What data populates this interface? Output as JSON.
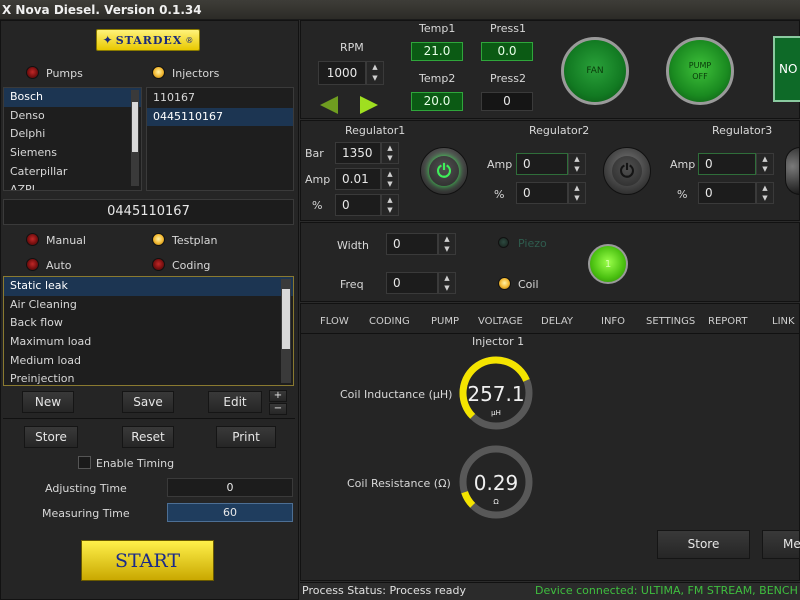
{
  "window": {
    "title": "X Nova Diesel. Version 0.1.34"
  },
  "logo": {
    "text": "STARDEX",
    "mark": "®"
  },
  "source": {
    "pumps_label": "Pumps",
    "injectors_label": "Injectors"
  },
  "manufacturers": [
    "Bosch",
    "Denso",
    "Delphi",
    "Siemens",
    "Caterpillar",
    "AZPI"
  ],
  "injectors": [
    "110167",
    "0445110167"
  ],
  "selected_injector": "0445110167",
  "mode": {
    "manual": "Manual",
    "testplan": "Testplan",
    "auto": "Auto",
    "coding": "Coding"
  },
  "tests": [
    "Static leak",
    "Air Cleaning",
    "Back flow",
    "Maximum load",
    "Medium load",
    "Preinjection"
  ],
  "buttons": {
    "new": "New",
    "save": "Save",
    "edit": "Edit",
    "plus": "+",
    "minus": "−",
    "store": "Store",
    "reset": "Reset",
    "print": "Print",
    "start": "START",
    "store_main": "Store",
    "more": "Me"
  },
  "timing": {
    "enable_label": "Enable Timing",
    "adjusting_label": "Adjusting Time",
    "adjusting_value": "0",
    "measuring_label": "Measuring Time",
    "measuring_value": "60"
  },
  "rpm": {
    "label": "RPM",
    "value": "1000"
  },
  "sensors": {
    "temp1_label": "Temp1",
    "temp1_value": "21.0",
    "press1_label": "Press1",
    "press1_value": "0.0",
    "temp2_label": "Temp2",
    "temp2_value": "20.0",
    "press2_label": "Press2",
    "press2_value": "0"
  },
  "fan": {
    "label": "FAN"
  },
  "pump": {
    "label": "PUMP OFF"
  },
  "no_button": {
    "label": "NO"
  },
  "regulators": {
    "r1": {
      "title": "Regulator1",
      "bar_label": "Bar",
      "bar_value": "1350",
      "amp_label": "Amp",
      "amp_value": "0.01",
      "pct_label": "%",
      "pct_value": "0"
    },
    "r2": {
      "title": "Regulator2",
      "amp_label": "Amp",
      "amp_value": "0",
      "pct_label": "%",
      "pct_value": "0"
    },
    "r3": {
      "title": "Regulator3",
      "amp_label": "Amp",
      "amp_value": "0",
      "pct_label": "%",
      "pct_value": "0"
    }
  },
  "pulse": {
    "width_label": "Width",
    "width_value": "0",
    "freq_label": "Freq",
    "freq_value": "0",
    "piezo_label": "Piezo",
    "coil_label": "Coil",
    "channel_value": "1"
  },
  "tabs": [
    "FLOW",
    "CODING",
    "PUMP",
    "VOLTAGE",
    "DELAY",
    "INFO",
    "SETTINGS",
    "REPORT",
    "LINK"
  ],
  "measurement": {
    "injector_title": "Injector 1",
    "inductance_label": "Coil Inductance (μH)",
    "inductance_value": "257.1",
    "inductance_unit": "μH",
    "inductance_fraction": 0.75,
    "resistance_label": "Coil Resistance (Ω)",
    "resistance_value": "0.29",
    "resistance_unit": "Ω",
    "resistance_fraction": 0.1
  },
  "status": {
    "process": "Process Status: Process ready",
    "device": "Device connected: ULTIMA, FM STREAM, BENCH"
  },
  "colors": {
    "accent_yellow": "#f4e400",
    "green_display": "#0b5a14",
    "selection_blue": "#1c3552",
    "status_green": "#3fbf3f"
  }
}
